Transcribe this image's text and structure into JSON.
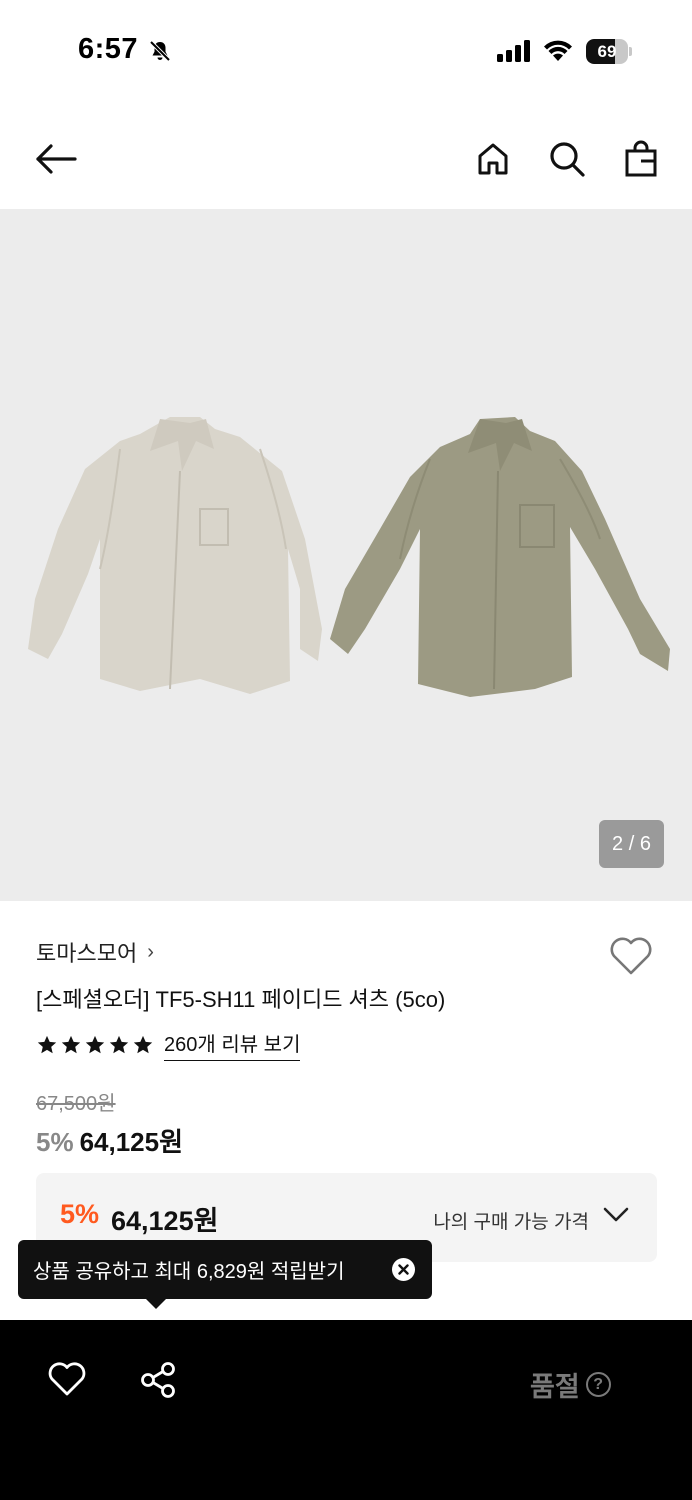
{
  "status_bar": {
    "time": "6:57",
    "battery": "69",
    "battery_level": 0.69,
    "icons": [
      "bell-slash-icon",
      "cellular-signal-icon",
      "wifi-icon",
      "battery-icon"
    ]
  },
  "nav": {
    "icons": [
      "back-arrow-icon",
      "home-icon",
      "search-icon",
      "shopping-bag-icon"
    ]
  },
  "gallery": {
    "page_counter": "2 / 6",
    "current_page": 2,
    "total_pages": 6
  },
  "product": {
    "brand": "토마스모어",
    "brand_chevron": "›",
    "title": "[스페셜오더] TF5-SH11 페이디드 셔츠 (5co)",
    "rating_stars": 5,
    "review_link": "260개 리뷰 보기",
    "original_price": "67,500원",
    "discount_pct": "5%",
    "sale_price": "64,125원"
  },
  "best_price": {
    "discount_pct": "5%",
    "price": "64,125원",
    "label": "나의 구매 가능 가격"
  },
  "tooltip": {
    "text": "상품 공유하고 최대 6,829원 적립받기"
  },
  "bottom_bar": {
    "status": "품절",
    "help": "?"
  },
  "colors": {
    "accent": "#ff5a1f",
    "gallery_bg": "#ececec",
    "bottom_bar_bg": "#000000",
    "shirt_light": "#d9d5cb",
    "shirt_olive": "#9c9a83"
  }
}
